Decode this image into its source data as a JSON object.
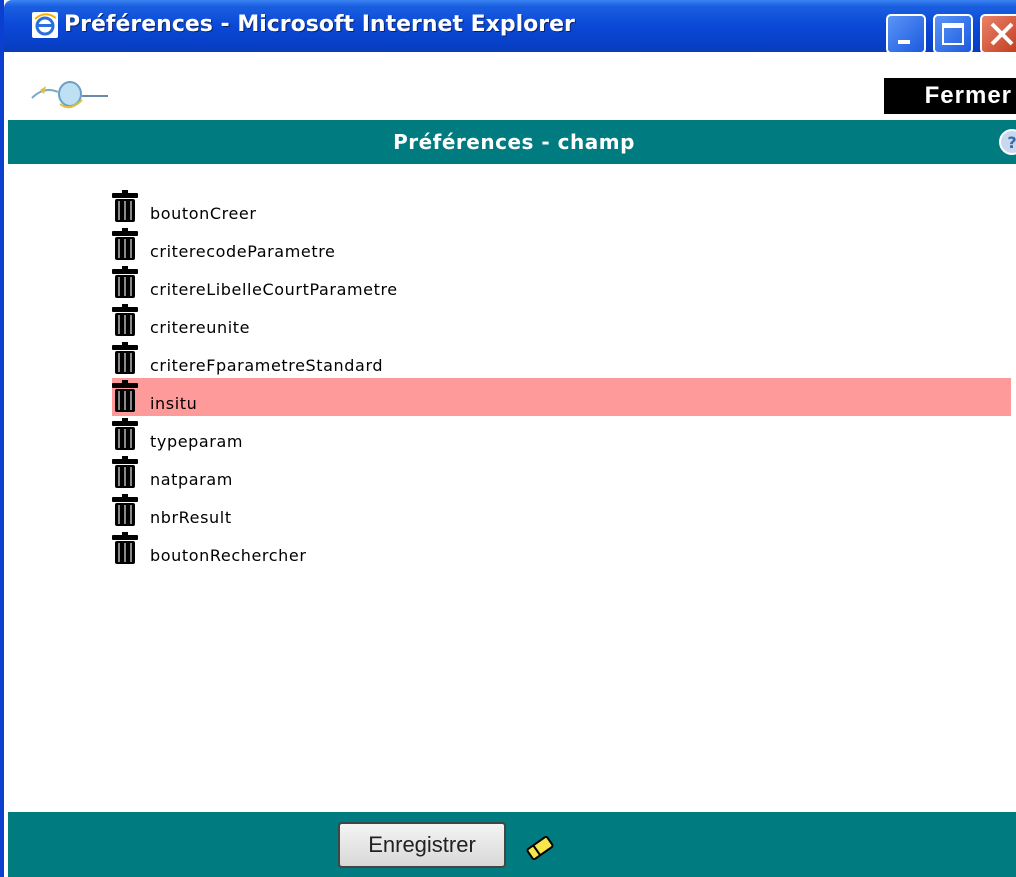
{
  "window": {
    "title": "Préférences - Microsoft Internet Explorer",
    "icons": [
      "ie-icon",
      "minimize-icon",
      "maximize-icon",
      "close-icon"
    ]
  },
  "topbar": {
    "logo_icon": "logo-icon",
    "close_label": "Fermer"
  },
  "header": {
    "title": "Préférences - champ",
    "help_icon": "help-icon"
  },
  "fields": {
    "items": [
      {
        "label": "boutonCreer",
        "highlighted": false
      },
      {
        "label": "criterecodeParametre",
        "highlighted": false
      },
      {
        "label": "critereLibelleCourtParametre",
        "highlighted": false
      },
      {
        "label": "critereunite",
        "highlighted": false
      },
      {
        "label": "critereFparametreStandard",
        "highlighted": false
      },
      {
        "label": "insitu",
        "highlighted": true
      },
      {
        "label": "typeparam",
        "highlighted": false
      },
      {
        "label": "natparam",
        "highlighted": false
      },
      {
        "label": "nbrResult",
        "highlighted": false
      },
      {
        "label": "boutonRechercher",
        "highlighted": false
      }
    ],
    "item_icon": "trash-icon"
  },
  "footer": {
    "save_label": "Enregistrer",
    "eraser_icon": "eraser-icon"
  },
  "colors": {
    "teal": "#007b7f",
    "highlight": "#ff9a9a",
    "titlebar_blue": "#0a48d6"
  }
}
